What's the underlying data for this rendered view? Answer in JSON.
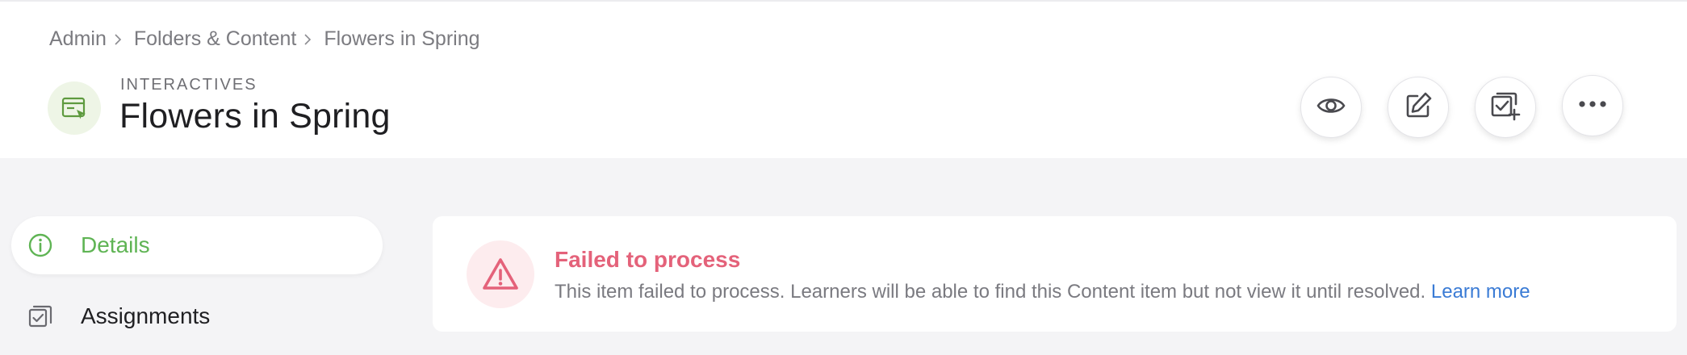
{
  "breadcrumb": {
    "items": [
      {
        "label": "Admin"
      },
      {
        "label": "Folders & Content"
      },
      {
        "label": "Flowers in Spring"
      }
    ]
  },
  "header": {
    "eyebrow": "INTERACTIVES",
    "title": "Flowers in Spring",
    "type_icon": "interactive-window-cursor-icon",
    "actions": [
      {
        "icon": "eye-icon",
        "name": "preview"
      },
      {
        "icon": "edit-icon",
        "name": "edit"
      },
      {
        "icon": "assign-icon",
        "name": "assign"
      },
      {
        "icon": "more-icon",
        "name": "more"
      }
    ]
  },
  "sidebar": {
    "items": [
      {
        "label": "Details",
        "icon": "info-icon",
        "active": true
      },
      {
        "label": "Assignments",
        "icon": "assignments-icon",
        "active": false
      }
    ]
  },
  "alert": {
    "icon": "warning-triangle-icon",
    "title": "Failed to process",
    "message": "This item failed to process. Learners will be able to find this Content item but not view it until resolved.",
    "link_label": "Learn more"
  },
  "colors": {
    "accent_green": "#5fb454",
    "error_pink": "#e4627a",
    "link_blue": "#3a7bd5",
    "page_bg": "#f4f4f6"
  }
}
